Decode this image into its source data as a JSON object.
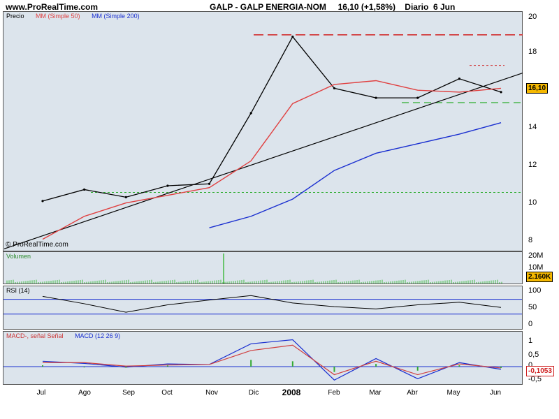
{
  "header": {
    "site": "www.ProRealTime.com",
    "title": "GALP - GALP ENERGIA-NOM     16,10 (+1,58%)    Diario  6 Jun"
  },
  "watermark": "© ProRealTime.com",
  "colors": {
    "panel_bg": "#dce4ec",
    "price": "#000000",
    "ma50": "#e04040",
    "ma200": "#1a2fd0",
    "volume": "#44bb44",
    "tag_bg": "#f5b800"
  },
  "price_panel": {
    "legend": [
      "Precio",
      "MM (Simple 50)",
      "MM (Simple 200)"
    ],
    "last_label": "16,10"
  },
  "volume_panel": {
    "legend": "Volumen",
    "last_label": "2.160K"
  },
  "rsi_panel": {
    "legend": "RSI (14)"
  },
  "macd_panel": {
    "legend_signal": "MACD-, señal Señal",
    "legend_macd": "MACD (12 26 9)",
    "last_label": "-0,1053"
  },
  "x_axis": {
    "labels": [
      "Jul",
      "Ago",
      "Sep",
      "Oct",
      "Nov",
      "Dic",
      "2008",
      "Feb",
      "Mar",
      "Abr",
      "May",
      "Jun"
    ]
  },
  "chart_data": [
    {
      "type": "line",
      "title": "GALP - GALP ENERGIA-NOM",
      "subtitle": "16,10 (+1,58%) Diario 6 Jun",
      "x": [
        "Jul",
        "Ago",
        "Sep",
        "Oct",
        "Nov",
        "Dic",
        "2008",
        "Feb",
        "Mar",
        "Abr",
        "May",
        "Jun"
      ],
      "ylim": [
        7.8,
        20.3
      ],
      "yticks": [
        "8",
        "10",
        "12",
        "14",
        "16",
        "18",
        "20"
      ],
      "series": [
        {
          "name": "Precio",
          "values": [
            10.4,
            11.0,
            10.6,
            11.2,
            11.3,
            15.0,
            19.0,
            16.3,
            15.8,
            15.8,
            16.8,
            16.1
          ]
        },
        {
          "name": "MM (Simple 50)",
          "values": [
            8.4,
            9.6,
            10.3,
            10.7,
            11.1,
            12.5,
            15.5,
            16.5,
            16.7,
            16.2,
            16.1,
            16.3
          ]
        },
        {
          "name": "MM (Simple 200)",
          "values": [
            null,
            null,
            null,
            null,
            9.0,
            9.6,
            10.5,
            12.0,
            12.9,
            13.4,
            13.9,
            14.5
          ]
        }
      ],
      "grid": false,
      "legend": "top-left"
    },
    {
      "type": "bar",
      "title": "Volumen",
      "yticks": [
        "10M",
        "20M"
      ],
      "last": "2.160K"
    },
    {
      "type": "line",
      "title": "RSI (14)",
      "ylim": [
        -10,
        105
      ],
      "yticks": [
        "0",
        "50",
        "100"
      ],
      "series": [
        {
          "name": "RSI (14)",
          "values": [
            78,
            58,
            35,
            55,
            68,
            80,
            60,
            50,
            44,
            55,
            62,
            48
          ]
        }
      ]
    },
    {
      "type": "line",
      "title": "MACD (12 26 9)",
      "ylim": [
        -0.65,
        1.3
      ],
      "yticks": [
        "1",
        "0,5",
        "0",
        "-0,5"
      ],
      "series": [
        {
          "name": "MACD (12 26 9)",
          "values": [
            0.2,
            0.12,
            -0.02,
            0.1,
            0.08,
            0.85,
            1.0,
            -0.5,
            0.3,
            -0.45,
            0.15,
            -0.1
          ]
        },
        {
          "name": "MACD-, señal Señal",
          "values": [
            0.15,
            0.15,
            0.02,
            0.06,
            0.08,
            0.6,
            0.8,
            -0.3,
            0.2,
            -0.3,
            0.1,
            -0.05
          ]
        }
      ],
      "last": "-0,1053"
    }
  ]
}
